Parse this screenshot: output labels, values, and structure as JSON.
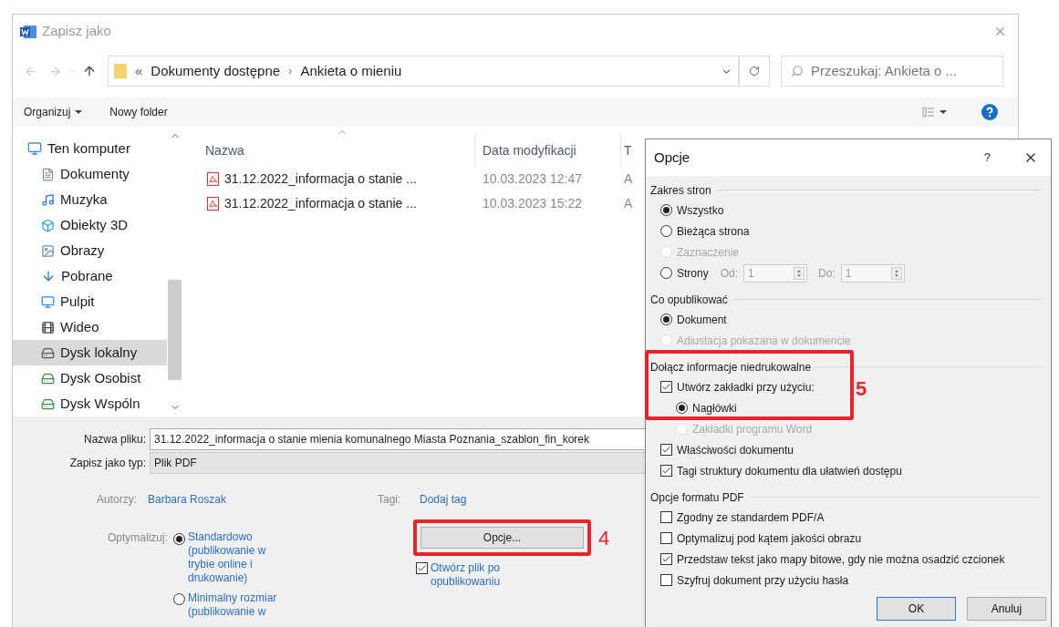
{
  "save_dialog": {
    "title": "Zapisz jako",
    "address": {
      "overflow": "«",
      "separator": "›",
      "path": [
        "Dokumenty dostępne",
        "Ankieta o mieniu"
      ]
    },
    "search": {
      "placeholder": "Przeszukaj: Ankieta o ..."
    },
    "toolbar": {
      "organize": "Organizuj",
      "new_folder": "Nowy folder"
    },
    "sidebar": {
      "items": [
        {
          "label": "Ten komputer",
          "selected": false
        },
        {
          "label": "Dokumenty",
          "selected": false
        },
        {
          "label": "Muzyka",
          "selected": false
        },
        {
          "label": "Obiekty 3D",
          "selected": false
        },
        {
          "label": "Obrazy",
          "selected": false
        },
        {
          "label": "Pobrane",
          "selected": false
        },
        {
          "label": "Pulpit",
          "selected": false
        },
        {
          "label": "Wideo",
          "selected": false
        },
        {
          "label": "Dysk lokalny",
          "selected": true
        },
        {
          "label": "Dysk Osobist",
          "selected": false
        },
        {
          "label": "Dysk Wspóln",
          "selected": false
        }
      ]
    },
    "file_list": {
      "columns": [
        "Nazwa",
        "Data modyfikacji",
        "T"
      ],
      "rows": [
        {
          "name": "31.12.2022_informacja o stanie ...",
          "date": "10.03.2023 12:47",
          "column_3": "A"
        },
        {
          "name": "31.12.2022_informacja o stanie ...",
          "date": "10.03.2023 15:22",
          "column_3": "A"
        }
      ]
    },
    "form": {
      "file_name_label": "Nazwa pliku:",
      "file_name": "31.12.2022_informacja o stanie mienia komunalnego Miasta Poznania_szablon_fin_korek",
      "type_label": "Zapisz jako typ:",
      "type": "Plik PDF",
      "authors_label": "Autorzy:",
      "authors": "Barbara Roszak",
      "tags_label": "Tagi:",
      "tags": "Dodaj tag",
      "optimize_label": "Optymalizuj:",
      "optimize_options": [
        {
          "label": "Standardowo (publikowanie w trybie online i drukowanie)",
          "selected": true
        },
        {
          "label": "Minimalny rozmiar (publikowanie w",
          "selected": false
        }
      ],
      "options_button": "Opcje...",
      "open_after": {
        "label": "Otwórz plik po opublikowaniu",
        "checked": true
      }
    }
  },
  "options_dialog": {
    "title": "Opcje",
    "help": "?",
    "sections": [
      {
        "heading": "Zakres stron",
        "items": [
          {
            "kind": "radio",
            "label": "Wszystko",
            "selected": true,
            "disabled": false
          },
          {
            "kind": "radio",
            "label": "Bieżąca strona",
            "selected": false,
            "disabled": false
          },
          {
            "kind": "radio",
            "label": "Zaznaczenie",
            "selected": false,
            "disabled": true
          },
          {
            "kind": "radio",
            "label": "Strony",
            "selected": false,
            "disabled": false,
            "range": {
              "from_label": "Od:",
              "from": "1",
              "to_label": "Do:",
              "to": "1"
            }
          }
        ]
      },
      {
        "heading": "Co opublikować",
        "items": [
          {
            "kind": "radio",
            "label": "Dokument",
            "selected": true,
            "disabled": false
          },
          {
            "kind": "radio",
            "label": "Adiustacja pokazana w dokumencie",
            "selected": false,
            "disabled": true
          }
        ]
      },
      {
        "heading": "Dołącz informacje niedrukowalne",
        "items": [
          {
            "kind": "checkbox",
            "label": "Utwórz zakładki przy użyciu:",
            "checked": true,
            "disabled": false,
            "children": [
              {
                "kind": "radio",
                "label": "Nagłówki",
                "selected": true,
                "disabled": false
              },
              {
                "kind": "radio",
                "label": "Zakładki programu Word",
                "selected": false,
                "disabled": true
              }
            ]
          },
          {
            "kind": "checkbox",
            "label": "Właściwości dokumentu",
            "checked": true,
            "disabled": false
          },
          {
            "kind": "checkbox",
            "label": "Tagi struktury dokumentu dla ułatwień dostępu",
            "checked": true,
            "disabled": false
          }
        ]
      },
      {
        "heading": "Opcje formatu PDF",
        "items": [
          {
            "kind": "checkbox",
            "label": "Zgodny ze standardem PDF/A",
            "checked": false,
            "disabled": false
          },
          {
            "kind": "checkbox",
            "label": "Optymalizuj pod kątem jakości obrazu",
            "checked": false,
            "disabled": false
          },
          {
            "kind": "checkbox",
            "label": "Przedstaw tekst jako mapy bitowe, gdy nie można osadzić czcionek",
            "checked": true,
            "disabled": false
          },
          {
            "kind": "checkbox",
            "label": "Szyfruj dokument przy użyciu hasła",
            "checked": false,
            "disabled": false
          }
        ]
      }
    ],
    "buttons": [
      "OK",
      "Anuluj"
    ]
  },
  "annotations": [
    {
      "label": "4"
    },
    {
      "label": "5"
    }
  ]
}
